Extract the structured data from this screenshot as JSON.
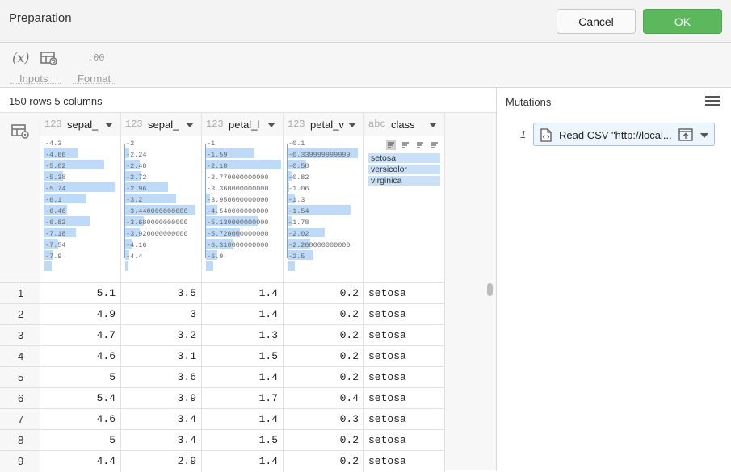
{
  "header": {
    "title": "Preparation",
    "cancel_label": "Cancel",
    "ok_label": "OK"
  },
  "toolbar": {
    "inputs_icon": "(x)",
    "inputs_label": "Inputs",
    "format_icon": ".00",
    "format_label": "Format"
  },
  "table": {
    "row_info": "150 rows 5 columns",
    "columns": [
      {
        "type": "123",
        "name": "sepal_",
        "hist_labels": [
          "4.3",
          "4.66",
          "5.02",
          "5.38",
          "5.74",
          "6.1",
          "6.46",
          "6.82",
          "7.18",
          "7.54",
          "7.9"
        ],
        "hist_values": [
          0.45,
          0.8,
          0.25,
          0.95,
          0.55,
          0.3,
          0.62,
          0.42,
          0.18,
          0.12,
          0.1
        ]
      },
      {
        "type": "123",
        "name": "sepal_",
        "hist_labels": [
          "2",
          "2.24",
          "2.48",
          "2.72",
          "2.96",
          "3.2",
          "3.440000000000",
          "3.680000000000",
          "3.920000000000",
          "4.16",
          "4.4"
        ],
        "hist_values": [
          0.05,
          0.2,
          0.22,
          0.58,
          0.68,
          0.95,
          0.25,
          0.2,
          0.1,
          0.05,
          0.04
        ]
      },
      {
        "type": "123",
        "name": "petal_l",
        "hist_labels": [
          "1",
          "1.59",
          "2.18",
          "2.770000000000",
          "3.360000000000",
          "3.950000000000",
          "4.540000000000",
          "5.130000000000",
          "5.720000000000",
          "6.310000000000",
          "6.9"
        ],
        "hist_values": [
          0.65,
          1.0,
          0.0,
          0.0,
          0.05,
          0.15,
          0.7,
          0.45,
          0.35,
          0.15,
          0.1
        ]
      },
      {
        "type": "123",
        "name": "petal_v",
        "hist_labels": [
          "0.1",
          "0.339999999999",
          "0.58",
          "0.82",
          "1.06",
          "1.3",
          "1.54",
          "1.78",
          "2.02",
          "2.260000000000",
          "2.5"
        ],
        "hist_values": [
          0.95,
          0.25,
          0.05,
          0.02,
          0.1,
          0.85,
          0.05,
          0.5,
          0.3,
          0.35,
          0.1
        ]
      },
      {
        "type": "abc",
        "name": "class",
        "categories": [
          "setosa",
          "versicolor",
          "virginica"
        ]
      }
    ],
    "rows": [
      {
        "idx": "1",
        "v": [
          "5.1",
          "3.5",
          "1.4",
          "0.2",
          "setosa"
        ]
      },
      {
        "idx": "2",
        "v": [
          "4.9",
          "3",
          "1.4",
          "0.2",
          "setosa"
        ]
      },
      {
        "idx": "3",
        "v": [
          "4.7",
          "3.2",
          "1.3",
          "0.2",
          "setosa"
        ]
      },
      {
        "idx": "4",
        "v": [
          "4.6",
          "3.1",
          "1.5",
          "0.2",
          "setosa"
        ]
      },
      {
        "idx": "5",
        "v": [
          "5",
          "3.6",
          "1.4",
          "0.2",
          "setosa"
        ]
      },
      {
        "idx": "6",
        "v": [
          "5.4",
          "3.9",
          "1.7",
          "0.4",
          "setosa"
        ]
      },
      {
        "idx": "7",
        "v": [
          "4.6",
          "3.4",
          "1.4",
          "0.3",
          "setosa"
        ]
      },
      {
        "idx": "8",
        "v": [
          "5",
          "3.4",
          "1.5",
          "0.2",
          "setosa"
        ]
      },
      {
        "idx": "9",
        "v": [
          "4.4",
          "2.9",
          "1.4",
          "0.2",
          "setosa"
        ]
      }
    ]
  },
  "mutations": {
    "title": "Mutations",
    "items": [
      {
        "num": "1",
        "label": "Read CSV \"http://local..."
      }
    ]
  }
}
